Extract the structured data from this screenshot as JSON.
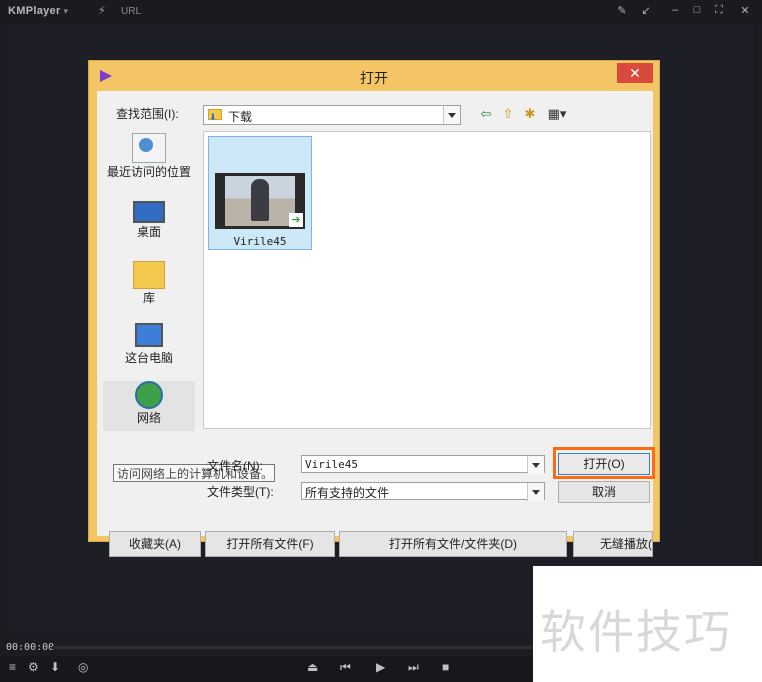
{
  "app": {
    "name": "KMPlayer",
    "url_label": "URL",
    "time": "00:00:00"
  },
  "dialog": {
    "title": "打开",
    "close_glyph": "✕",
    "look_in_label": "查找范围(I):",
    "look_in_value": "下载",
    "places": [
      {
        "label": "最近访问的位置",
        "icon": "recent-places-icon"
      },
      {
        "label": "桌面",
        "icon": "desktop-icon"
      },
      {
        "label": "库",
        "icon": "library-icon"
      },
      {
        "label": "这台电脑",
        "icon": "computer-icon"
      },
      {
        "label": "网络",
        "icon": "network-icon"
      }
    ],
    "files": [
      {
        "name": "Virile45",
        "icon": "video-file-icon"
      }
    ],
    "tooltip": "访问网络上的计算机和设备。",
    "filename_label": "文件名(N):",
    "filename_value": "Virile45",
    "filetype_label": "文件类型(T):",
    "filetype_value": "所有支持的文件",
    "open_button": "打开(O)",
    "cancel_button": "取消",
    "bottom_buttons": [
      "收藏夹(A)",
      "打开所有文件(F)",
      "打开所有文件/文件夹(D)",
      "无缝播放("
    ]
  },
  "watermark": "软件技巧",
  "colors": {
    "dialog_frame": "#f3c564",
    "close_button": "#d94a3c",
    "highlight": "#ff6a13",
    "selected_item": "#cde8f7"
  }
}
